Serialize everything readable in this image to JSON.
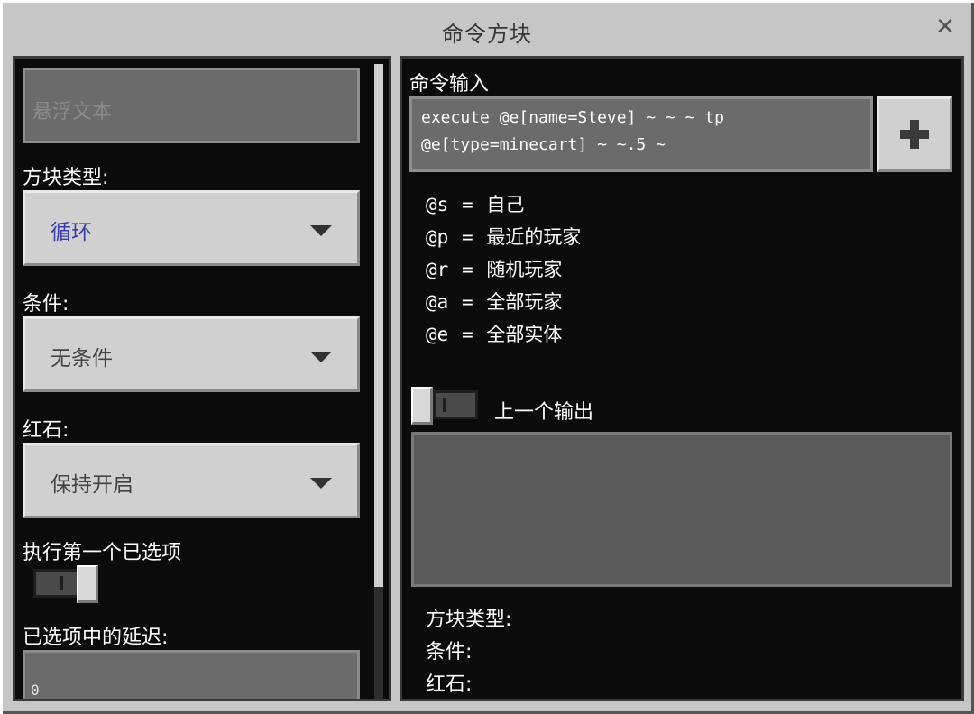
{
  "window": {
    "title": "命令方块",
    "close_icon": "close-icon"
  },
  "left": {
    "hover_text_placeholder": "悬浮文本",
    "block_type_label": "方块类型:",
    "block_type_value": "循环",
    "block_type_value_color": "#3b3bb0",
    "condition_label": "条件:",
    "condition_value": "无条件",
    "redstone_label": "红石:",
    "redstone_value": "保持开启",
    "execute_first_label": "执行第一个已选项",
    "execute_first_enabled": true,
    "delay_label": "已选项中的延迟:",
    "delay_value": "0"
  },
  "right": {
    "command_input_label": "命令输入",
    "command_line_1": "execute @e[name=Steve] ~ ~ ~ tp",
    "command_line_2": "@e[type=minecart] ~ ~.5 ~",
    "add_button_icon": "plus-icon",
    "selectors": [
      {
        "key": "@s",
        "sep": "=",
        "desc": "自己"
      },
      {
        "key": "@p",
        "sep": "=",
        "desc": "最近的玩家"
      },
      {
        "key": "@r",
        "sep": "=",
        "desc": "随机玩家"
      },
      {
        "key": "@a",
        "sep": "=",
        "desc": "全部玩家"
      },
      {
        "key": "@e",
        "sep": "=",
        "desc": "全部实体"
      }
    ],
    "previous_output_label": "上一个输出",
    "previous_output_enabled": false,
    "previous_output_text": "",
    "summary_block_type": "方块类型:",
    "summary_condition": "条件:",
    "summary_redstone": "红石:"
  }
}
